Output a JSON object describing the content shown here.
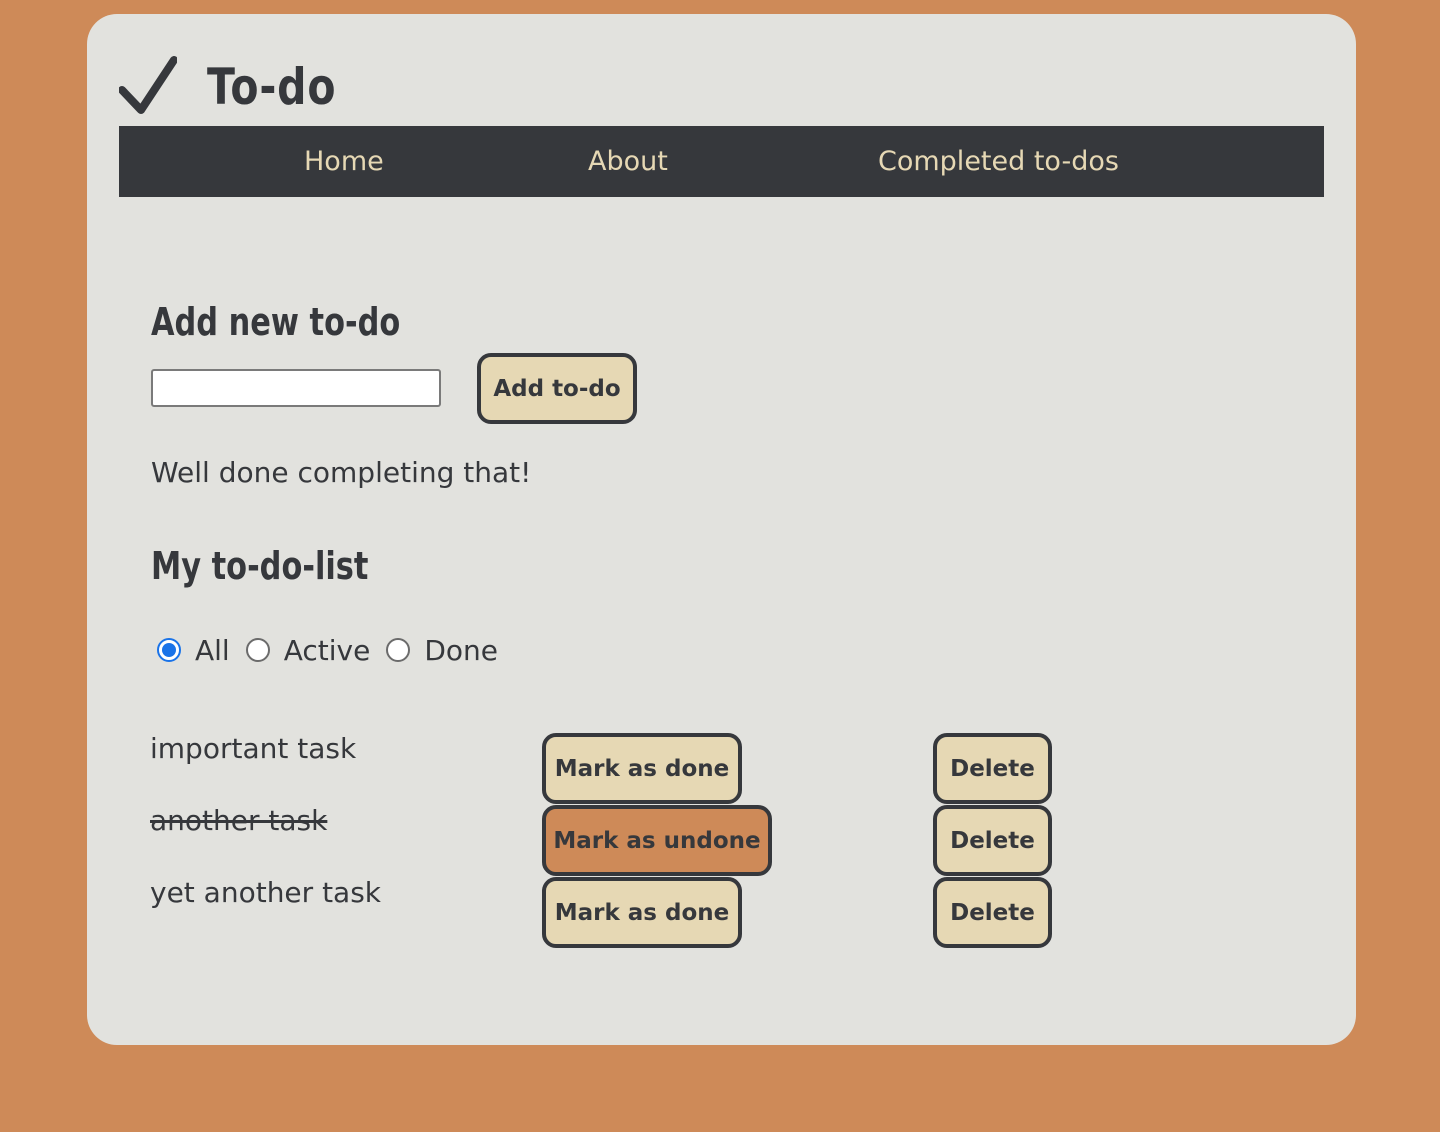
{
  "colors": {
    "page_background": "#CE8A58",
    "card_background": "#E2E2DE",
    "navbar_background": "#36383C",
    "nav_text": "#E6D8B4",
    "button_background": "#E6D8B4",
    "button_undone_background": "#CE8A58",
    "text": "#36383C",
    "radio_selected": "#1A73E8"
  },
  "header": {
    "icon": "checkmark-icon",
    "title": "To-do"
  },
  "nav": {
    "items": [
      {
        "label": "Home"
      },
      {
        "label": "About"
      },
      {
        "label": "Completed to-dos"
      }
    ]
  },
  "add_section": {
    "heading": "Add new to-do",
    "input_value": "",
    "button_label": "Add to-do"
  },
  "message": "Well done completing that!",
  "list_section": {
    "heading": "My to-do-list",
    "filters": [
      {
        "label": "All",
        "selected": true
      },
      {
        "label": "Active",
        "selected": false
      },
      {
        "label": "Done",
        "selected": false
      }
    ],
    "tasks": [
      {
        "text": "important task",
        "done": false,
        "toggle_label": "Mark as done",
        "delete_label": "Delete"
      },
      {
        "text": "another task",
        "done": true,
        "toggle_label": "Mark as undone",
        "delete_label": "Delete"
      },
      {
        "text": "yet another task",
        "done": false,
        "toggle_label": "Mark as done",
        "delete_label": "Delete"
      }
    ]
  }
}
